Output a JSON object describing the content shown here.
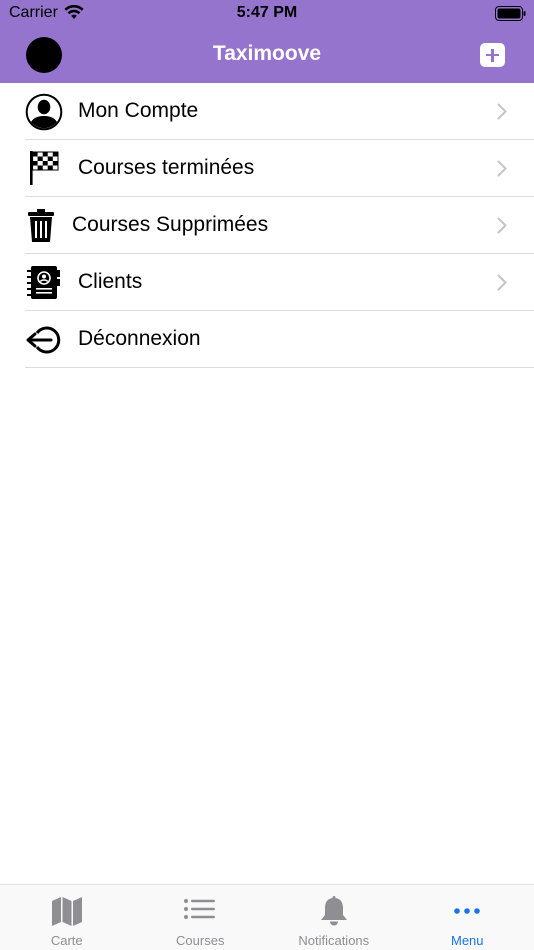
{
  "status_bar": {
    "carrier": "Carrier",
    "time": "5:47 PM"
  },
  "nav": {
    "title": "Taximoove",
    "avatar_icon": "avatar-circle",
    "add_icon": "plus-square-icon"
  },
  "menu": {
    "items": [
      {
        "label": "Mon Compte",
        "icon": "user-circle-icon",
        "has_chevron": true
      },
      {
        "label": "Courses terminées",
        "icon": "checkered-flag-icon",
        "has_chevron": true
      },
      {
        "label": "Courses Supprimées",
        "icon": "trash-icon",
        "has_chevron": true
      },
      {
        "label": "Clients",
        "icon": "address-book-icon",
        "has_chevron": true
      },
      {
        "label": "Déconnexion",
        "icon": "logout-icon",
        "has_chevron": false
      }
    ]
  },
  "tab_bar": {
    "tabs": [
      {
        "label": "Carte",
        "icon": "map-icon",
        "active": false
      },
      {
        "label": "Courses",
        "icon": "list-icon",
        "active": false
      },
      {
        "label": "Notifications",
        "icon": "bell-icon",
        "active": false
      },
      {
        "label": "Menu",
        "icon": "more-dots-icon",
        "active": true
      }
    ]
  },
  "colors": {
    "header": "#9574cd",
    "active_tab": "#1a73e8",
    "inactive_tab": "#8e8e93",
    "separator": "#dcdcde"
  }
}
